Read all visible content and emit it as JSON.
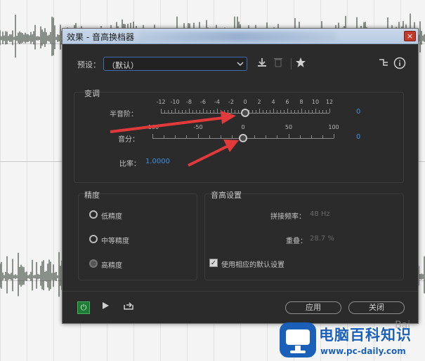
{
  "window": {
    "title": "效果 - 音高换档器",
    "close_glyph": "×"
  },
  "preset": {
    "label": "预设：",
    "value": "（默认）"
  },
  "icons": [
    "download-icon",
    "trash-icon",
    "star-icon",
    "routing-icon",
    "info-icon"
  ],
  "transpose": {
    "title": "变调",
    "semitones": {
      "label": "半音阶：",
      "ticks": [
        "-12",
        "-10",
        "-8",
        "-6",
        "-4",
        "-2",
        "0",
        "2",
        "4",
        "6",
        "8",
        "10",
        "12"
      ],
      "value": "0",
      "position": 0.5
    },
    "cents": {
      "label": "音分：",
      "ticks": [
        "-100",
        "-50",
        "0",
        "50",
        "100"
      ],
      "value": "0",
      "position": 0.5
    },
    "ratio": {
      "label": "比率：",
      "value": "1.0000"
    }
  },
  "precision": {
    "title": "精度",
    "options": [
      {
        "label": "低精度",
        "selected": false
      },
      {
        "label": "中等精度",
        "selected": false
      },
      {
        "label": "高精度",
        "selected": true
      }
    ]
  },
  "pitch_settings": {
    "title": "音高设置",
    "splice_freq": {
      "label": "拼接频率：",
      "value": "48 Hz"
    },
    "overlap": {
      "label": "重叠：",
      "value": "28.7 %"
    },
    "use_default": {
      "label": "使用相应的默认设置",
      "checked": true
    }
  },
  "footer": {
    "apply": "应用",
    "close": "关闭"
  },
  "watermark": {
    "name": "电脑百科知识",
    "url": "www.pc-daily.com",
    "baidu": "Bai"
  },
  "colors": {
    "accent": "#3d8fe0",
    "panel": "#2b2b2b",
    "arrow": "#e23a3a",
    "power": "#1f7a35"
  }
}
